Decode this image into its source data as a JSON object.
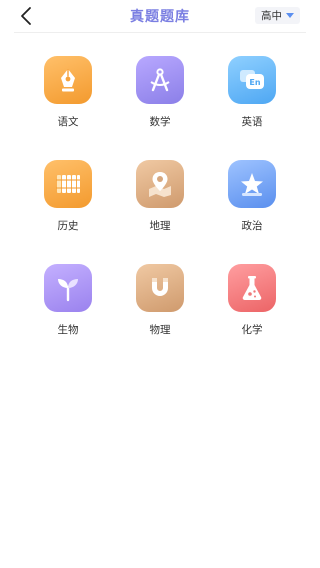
{
  "header": {
    "title": "真题题库",
    "level_select": "高中"
  },
  "subjects": [
    {
      "label": "语文",
      "icon": "pen-nib-icon",
      "color": "#f6a33d"
    },
    {
      "label": "数学",
      "icon": "compass-icon",
      "color": "#9b8ef2"
    },
    {
      "label": "英语",
      "icon": "en-chat-icon",
      "color": "#5fb2f5"
    },
    {
      "label": "历史",
      "icon": "bamboo-scroll-icon",
      "color": "#f5a23a"
    },
    {
      "label": "地理",
      "icon": "map-pin-icon",
      "color": "#d6a77f"
    },
    {
      "label": "政治",
      "icon": "star-icon",
      "color": "#6c9ef1"
    },
    {
      "label": "生物",
      "icon": "sprout-icon",
      "color": "#a98df0"
    },
    {
      "label": "物理",
      "icon": "magnet-icon",
      "color": "#d6a77f"
    },
    {
      "label": "化学",
      "icon": "flask-icon",
      "color": "#f0787a"
    }
  ]
}
